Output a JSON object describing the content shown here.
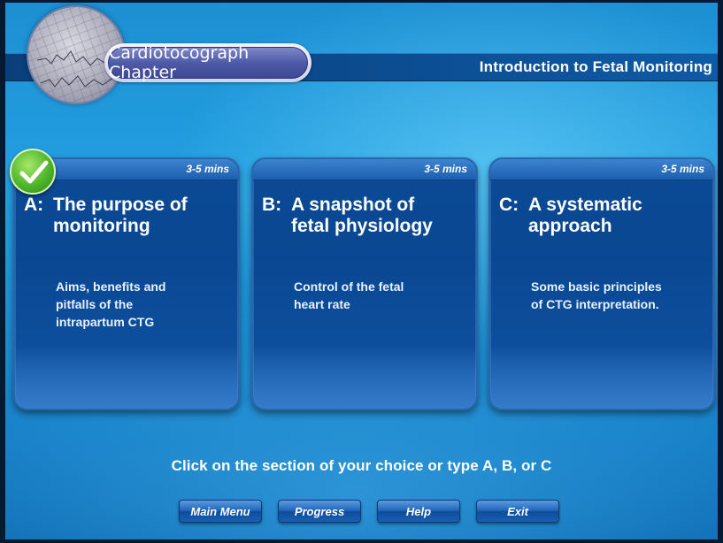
{
  "header": {
    "chapter_label": "Cardiotocograph Chapter",
    "title": "Introduction to Fetal Monitoring"
  },
  "sections": [
    {
      "letter": "A:",
      "title_line1": "The purpose of",
      "title_line2": "monitoring",
      "duration": "3-5 mins",
      "desc_lines": [
        "Aims, benefits and",
        "pitfalls of the",
        "intrapartum CTG"
      ],
      "completed": true
    },
    {
      "letter": "B:",
      "title_line1": "A snapshot of",
      "title_line2": "fetal physiology",
      "duration": "3-5 mins",
      "desc_lines": [
        "Control of the fetal",
        "heart rate"
      ],
      "completed": false
    },
    {
      "letter": "C:",
      "title_line1": "A systematic",
      "title_line2": "approach",
      "duration": "3-5 mins",
      "desc_lines": [
        "Some basic principles",
        "of CTG interpretation."
      ],
      "completed": false
    }
  ],
  "instruction": "Click on the section of your choice or type A, B, or C",
  "buttons": {
    "main_menu": "Main Menu",
    "progress": "Progress",
    "help": "Help",
    "exit": "Exit"
  },
  "icons": {
    "photo": "ctg-paper-photo-icon",
    "completed": "check-icon"
  },
  "colors": {
    "background": "#1c8fd2",
    "header_band": "#0b4a8c",
    "card": "#0b4a96",
    "check": "#4fb52a"
  }
}
